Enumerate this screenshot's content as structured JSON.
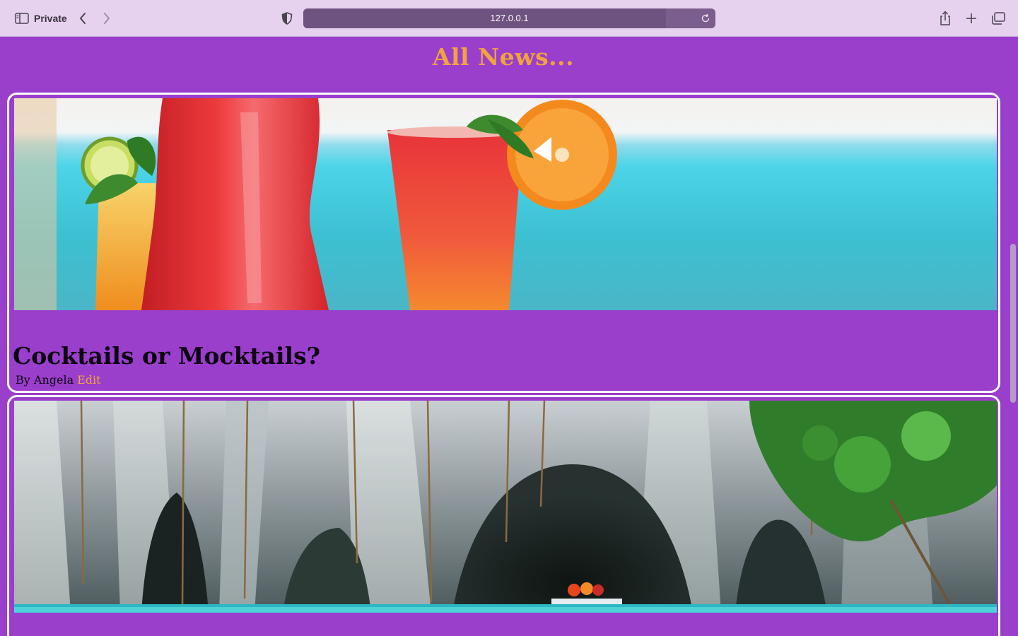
{
  "browser": {
    "private_label": "Private",
    "url": "127.0.0.1",
    "load_progress": 0.88,
    "icons": {
      "sidebar": "sidebar-icon",
      "back": "chevron-left-icon",
      "forward": "chevron-right-icon",
      "shield": "privacy-shield-icon",
      "reload": "reload-icon",
      "share": "share-icon",
      "new_tab": "plus-icon",
      "tabs": "tab-overview-icon"
    }
  },
  "page": {
    "title": "All News...",
    "colors": {
      "background": "#9a3ecc",
      "accent": "#f1a43b",
      "card_border": "#ffffff"
    }
  },
  "posts": [
    {
      "image": "cocktails-beach-image",
      "title": "Cocktails or Mocktails?",
      "byline": "By Angela",
      "edit_label": "Edit"
    },
    {
      "image": "sea-cave-image"
    }
  ]
}
